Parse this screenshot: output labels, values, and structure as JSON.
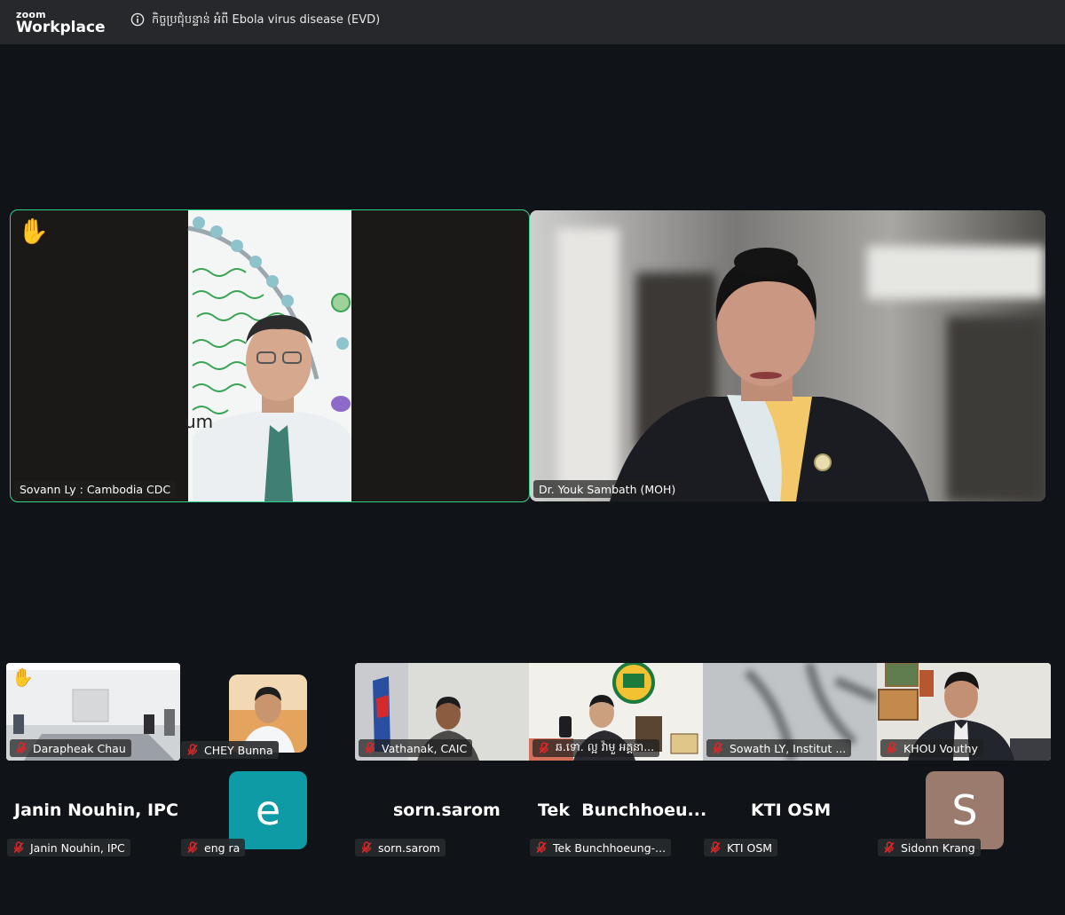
{
  "app": {
    "logo_top": "zoom",
    "logo_bottom": "Workplace"
  },
  "meeting": {
    "title": "កិច្ចប្រជុំបន្ទាន់ អំពី Ebola virus disease (EVD)"
  },
  "colors": {
    "active_speaker": "#2fd38a",
    "muted_icon": "#e02828",
    "avatar_e": "#0f9ba6",
    "avatar_s": "#9b7b6e"
  },
  "icons": {
    "hand": "✋"
  },
  "main_tiles": [
    {
      "name": "Sovann Ly : Cambodia CDC",
      "hand_raised": true,
      "active": true,
      "slide_text": "um"
    },
    {
      "name": "Dr. Youk Sambath (MOH)",
      "hand_raised": false,
      "active": false
    }
  ],
  "gallery_video": [
    {
      "name": "Darapheak Chau",
      "muted": true,
      "hand_raised": true
    },
    {
      "name": "CHEY Bunna",
      "muted": true
    },
    {
      "name": "Vathanak, CAIC",
      "muted": true
    },
    {
      "name": "ឆ.ទោ. ល្អ វ៉ាមួ អគ្គនា...",
      "muted": true
    },
    {
      "name": "Sowath LY, Institut ...",
      "muted": true
    },
    {
      "name": "KHOU Vouthy",
      "muted": true
    }
  ],
  "gallery_audio": [
    {
      "display": "Janin Nouhin, IPC",
      "tag": "Janin Nouhin, IPC"
    },
    {
      "display": "e",
      "tag": "eng ra"
    },
    {
      "display": "sorn.sarom",
      "tag": "sorn.sarom"
    },
    {
      "display": "Tek  Bunchhoeu...",
      "tag": "Tek Bunchhoeung-..."
    },
    {
      "display": "KTI OSM",
      "tag": "KTI OSM"
    },
    {
      "display": "S",
      "tag": "Sidonn Krang"
    }
  ]
}
